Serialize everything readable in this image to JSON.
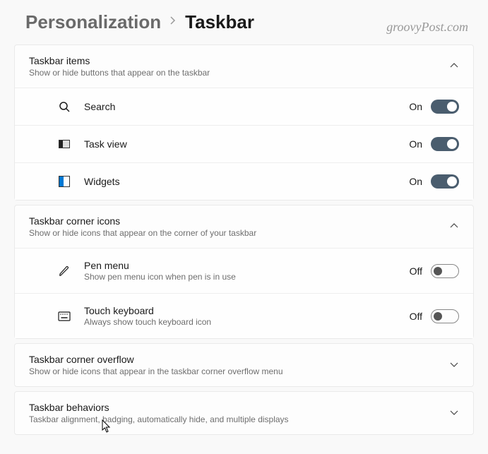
{
  "breadcrumb": {
    "parent": "Personalization",
    "current": "Taskbar"
  },
  "watermark": "groovyPost.com",
  "states": {
    "on": "On",
    "off": "Off"
  },
  "sections": {
    "items": {
      "title": "Taskbar items",
      "subtitle": "Show or hide buttons that appear on the taskbar",
      "rows": {
        "search": {
          "label": "Search"
        },
        "taskview": {
          "label": "Task view"
        },
        "widgets": {
          "label": "Widgets"
        }
      }
    },
    "cornerIcons": {
      "title": "Taskbar corner icons",
      "subtitle": "Show or hide icons that appear on the corner of your taskbar",
      "rows": {
        "pen": {
          "label": "Pen menu",
          "desc": "Show pen menu icon when pen is in use"
        },
        "touch": {
          "label": "Touch keyboard",
          "desc": "Always show touch keyboard icon"
        }
      }
    },
    "overflow": {
      "title": "Taskbar corner overflow",
      "subtitle": "Show or hide icons that appear in the taskbar corner overflow menu"
    },
    "behaviors": {
      "title": "Taskbar behaviors",
      "subtitle": "Taskbar alignment, badging, automatically hide, and multiple displays"
    }
  }
}
